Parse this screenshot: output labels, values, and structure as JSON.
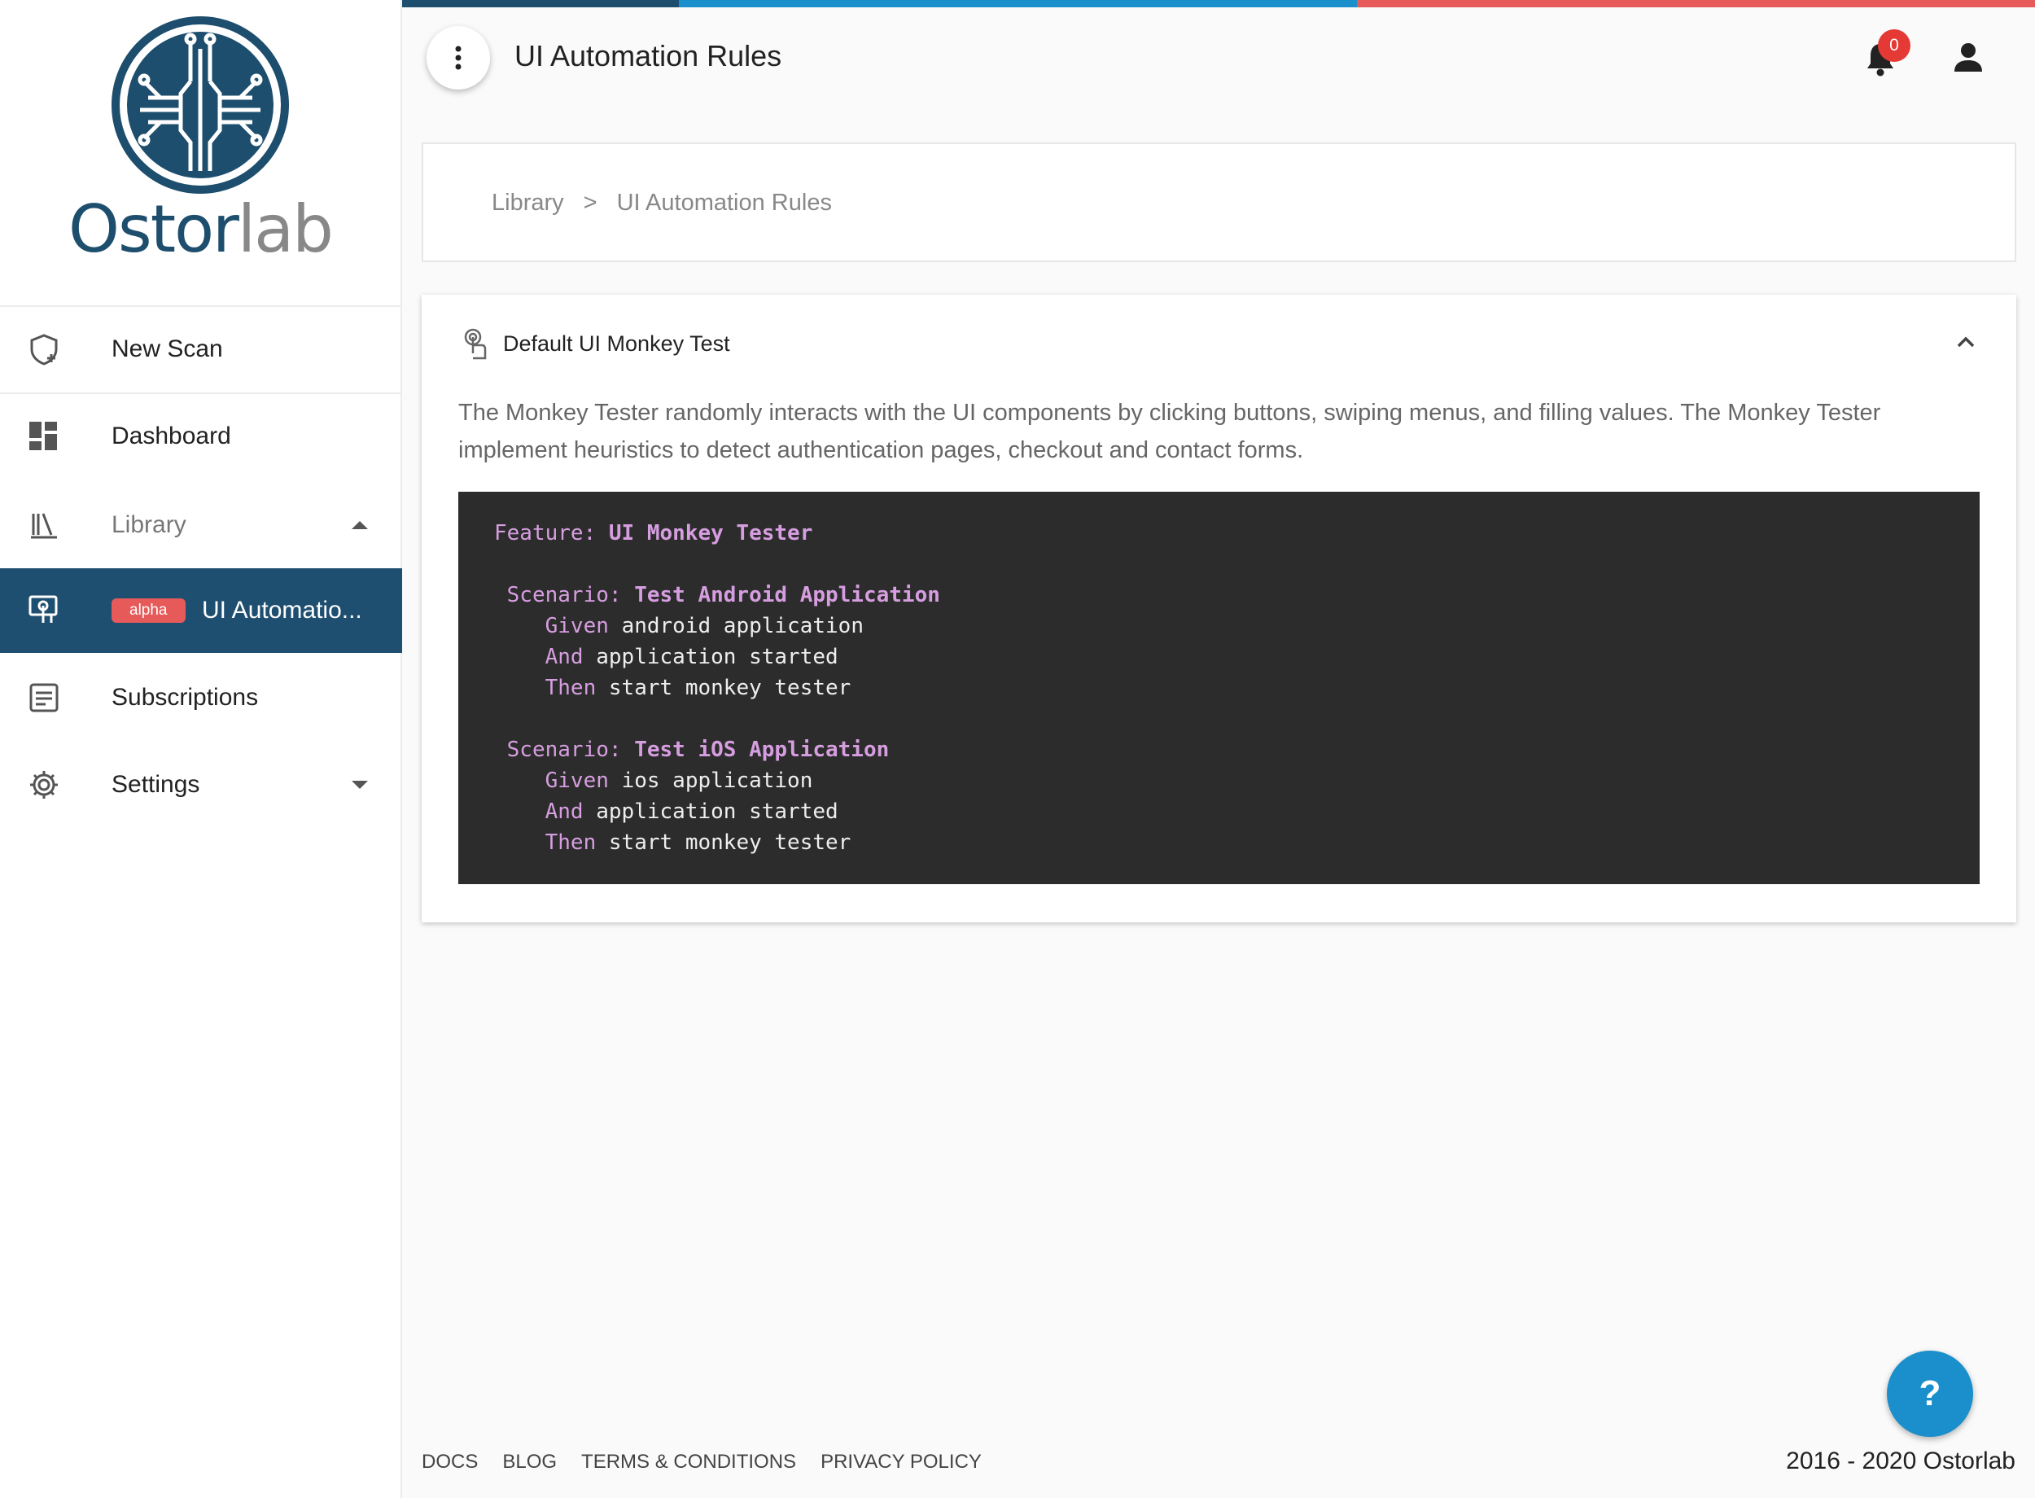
{
  "brand": {
    "name_part1": "Ostor",
    "name_part2": "lab",
    "primary_color": "#1d4e6e"
  },
  "sidebar": {
    "items": [
      {
        "label": "New Scan",
        "icon": "shield-plus-icon"
      },
      {
        "label": "Dashboard",
        "icon": "dashboard-icon"
      },
      {
        "label": "Library",
        "icon": "library-icon",
        "expanded": true
      },
      {
        "label": "UI Automatio...",
        "badge": "alpha",
        "icon": "touch-screen-icon",
        "active": true
      },
      {
        "label": "Subscriptions",
        "icon": "subscriptions-icon"
      },
      {
        "label": "Settings",
        "icon": "gear-icon",
        "expanded": false
      }
    ]
  },
  "header": {
    "title": "UI Automation Rules",
    "notifications_count": "0"
  },
  "breadcrumb": {
    "items": [
      "Library",
      "UI Automation Rules"
    ],
    "separator": ">"
  },
  "rule": {
    "title": "Default UI Monkey Test",
    "description": "The Monkey Tester randomly interacts with the UI components by clicking buttons, swiping menus, and filling values. The Monkey Tester implement heuristics to detect authentication pages, checkout and contact forms.",
    "code": {
      "feature_kw": "Feature:",
      "feature_name": "UI Monkey Tester",
      "scenarios": [
        {
          "kw": "Scenario:",
          "name": "Test Android Application",
          "steps": [
            [
              "Given",
              "android application"
            ],
            [
              "And",
              "application started"
            ],
            [
              "Then",
              "start monkey tester"
            ]
          ]
        },
        {
          "kw": "Scenario:",
          "name": "Test iOS Application",
          "steps": [
            [
              "Given",
              "ios application"
            ],
            [
              "And",
              "application started"
            ],
            [
              "Then",
              "start monkey tester"
            ]
          ]
        }
      ]
    }
  },
  "footer": {
    "links": [
      "DOCS",
      "BLOG",
      "TERMS & CONDITIONS",
      "PRIVACY POLICY"
    ],
    "copyright": "2016 - 2020 Ostorlab"
  },
  "help_button": {
    "label": "?"
  },
  "colors": {
    "stripe1": "#1d4e6e",
    "stripe2": "#1a8fcb",
    "stripe3": "#e65a5a",
    "code_keyword": "#d69ee0"
  }
}
